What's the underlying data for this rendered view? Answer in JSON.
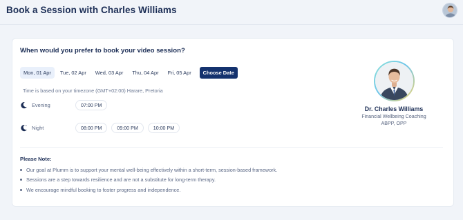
{
  "header": {
    "title": "Book a Session with Charles Williams",
    "avatar_icon": "user-avatar"
  },
  "booking": {
    "question": "When would you prefer to book your video session?",
    "dates": [
      {
        "label": "Mon, 01 Apr",
        "selected": true
      },
      {
        "label": "Tue, 02 Apr",
        "selected": false
      },
      {
        "label": "Wed, 03 Apr",
        "selected": false
      },
      {
        "label": "Thu, 04 Apr",
        "selected": false
      },
      {
        "label": "Fri, 05 Apr",
        "selected": false
      }
    ],
    "choose_date_label": "Choose Date",
    "timezone_note": "Time is based on your timezone (GMT+02:00) Harare, Pretoria",
    "evening": {
      "label": "Evening",
      "icon": "moon-icon",
      "times": [
        "07:00 PM"
      ]
    },
    "night": {
      "label": "Night",
      "icon": "moon-night-icon",
      "times": [
        "08:00 PM",
        "09:00 PM",
        "10:00 PM"
      ]
    }
  },
  "coach": {
    "name": "Dr. Charles Williams",
    "role": "Financial Wellbeing Coaching",
    "credentials": "ABPP, OPP"
  },
  "notes": {
    "title": "Please Note:",
    "items": [
      "Our goal at Plumm is to support your mental well-being effectively within a short-term, session-based framework.",
      "Sessions are a step towards resilience and are not a substitute for long-term therapy.",
      "We encourage mindful booking to foster progress and independence."
    ]
  },
  "colors": {
    "primary": "#14326e",
    "selected_chip": "#e9f0fb",
    "text_dark": "#1b2d55",
    "text_muted": "#5b6885",
    "background": "#f1f4f9"
  }
}
